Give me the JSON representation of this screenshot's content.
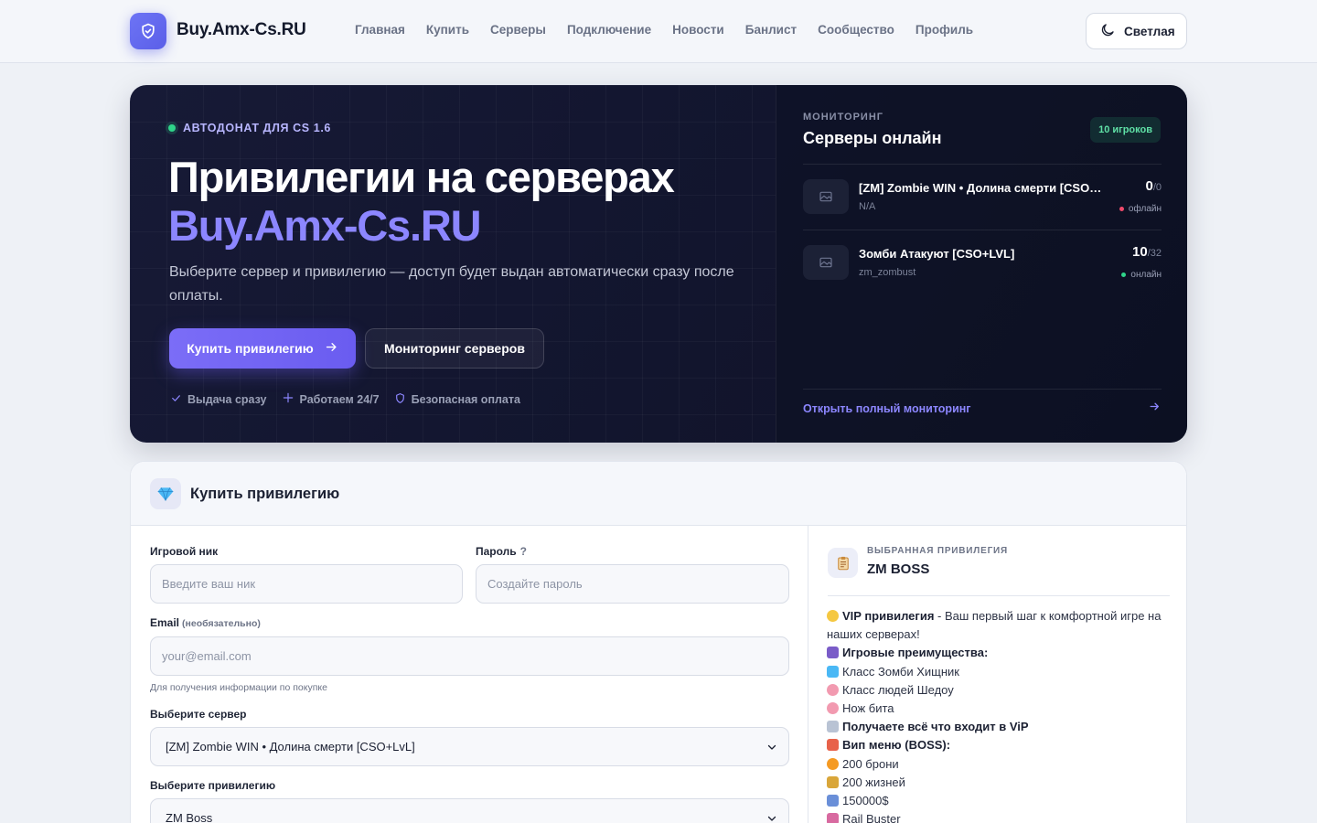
{
  "header": {
    "brand": "Buy.Amx-Cs.RU",
    "nav": [
      "Главная",
      "Купить",
      "Серверы",
      "Подключение",
      "Новости",
      "Банлист",
      "Сообщество",
      "Профиль"
    ],
    "theme_label": "Светлая"
  },
  "hero": {
    "badge": "АВТОДОНАТ ДЛЯ CS 1.6",
    "title_line1": "Привилегии на серверах",
    "title_line2": "Buy.Amx-Cs.RU",
    "subtitle": "Выберите сервер и привилегию — доступ будет выдан автоматически сразу после оплаты.",
    "primary_button": "Купить привилегию",
    "secondary_button": "Мониторинг серверов",
    "features": [
      "Выдача сразу",
      "Работаем 24/7",
      "Безопасная оплата"
    ]
  },
  "monitoring": {
    "label": "МОНИТОРИНГ",
    "title": "Серверы онлайн",
    "count": "10 игроков",
    "servers": [
      {
        "name": "[ZM] Zombie WIN • Долина смерти [CSO+LvL]",
        "map": "N/A",
        "players": "0",
        "max": "/0",
        "status": "офлайн",
        "status_color": "#ef4a6b"
      },
      {
        "name": "Зомби Атакуют [CSO+LVL]",
        "map": "zm_zombust",
        "players": "10",
        "max": "/32",
        "status": "онлайн",
        "status_color": "#2fd48a"
      }
    ],
    "link": "Открыть полный мониторинг"
  },
  "purchase": {
    "title": "Купить привилегию",
    "nick_label": "Игровой ник",
    "nick_placeholder": "Введите ваш ник",
    "password_label": "Пароль",
    "password_q": "?",
    "password_placeholder": "Создайте пароль",
    "email_label": "Email",
    "email_optional": "(необязательно)",
    "email_placeholder": "your@email.com",
    "email_hint": "Для получения информации по покупке",
    "server_label": "Выберите сервер",
    "server_value": "[ZM] Zombie WIN • Долина смерти [CSO+LvL]",
    "privilege_label": "Выберите привилегию",
    "privilege_value": "ZM Boss"
  },
  "selected": {
    "label": "ВЫБРАННАЯ ПРИВИЛЕГИЯ",
    "name": "ZM BOSS",
    "intro_bold": "VIP привилегия",
    "intro_text": " - Ваш первый шаг к комфортной игре на наших серверах!",
    "benefits_title": "Игровые преимущества:",
    "benefits": [
      "Класс Зомби Хищник",
      "Класс людей Шедоу",
      "Нож бита"
    ],
    "includes": "Получаете всё что входит в ViP",
    "menu_title": "Вип меню (BOSS):",
    "menu_items": [
      "200 брони",
      "200 жизней",
      "150000$",
      "Rail Buster"
    ]
  },
  "colors": {
    "accent": "#7b6df7",
    "online": "#2fd48a",
    "offline": "#ef4a6b"
  }
}
